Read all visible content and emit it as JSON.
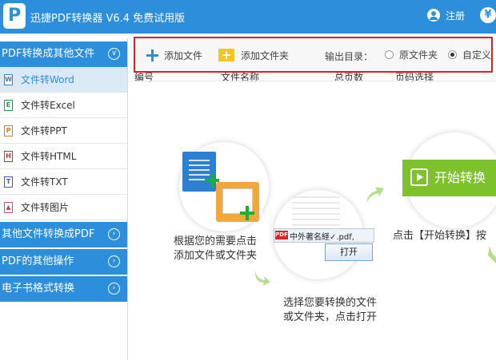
{
  "window": {
    "logo_letter": "P",
    "title": "迅捷PDF转换器 V6.4 免费试用版",
    "register_label": "注册",
    "currency_symbol": "¥"
  },
  "sidebar": {
    "sections": [
      {
        "label": "PDF转换成其他文件",
        "expanded": true,
        "items": [
          {
            "label": "文件转Word",
            "icon_text": "W",
            "active": true
          },
          {
            "label": "文件转Excel",
            "icon_text": "E",
            "active": false
          },
          {
            "label": "文件转PPT",
            "icon_text": "P",
            "active": false
          },
          {
            "label": "文件转HTML",
            "icon_text": "H",
            "active": false
          },
          {
            "label": "文件转TXT",
            "icon_text": "T",
            "active": false
          },
          {
            "label": "文件转图片",
            "icon_text": "▲",
            "active": false
          }
        ]
      },
      {
        "label": "其他文件转换成PDF",
        "expanded": false
      },
      {
        "label": "PDF的其他操作",
        "expanded": false
      },
      {
        "label": "电子书格式转换",
        "expanded": false
      }
    ]
  },
  "toolbar": {
    "add_file_label": "添加文件",
    "add_folder_label": "添加文件夹",
    "output_label": "输出目录：",
    "output_options": [
      {
        "label": "原文件夹",
        "checked": false
      },
      {
        "label": "自定义",
        "checked": true
      }
    ]
  },
  "table": {
    "columns": [
      "编号",
      "文件名称",
      "总页数",
      "页码选择"
    ]
  },
  "guide": {
    "step1": [
      "根据您的需要点击",
      "添加文件或文件夹"
    ],
    "step2": [
      "选择您要转换的文件",
      "或文件夹，点击打开"
    ],
    "step3": "点击【开始转换】按",
    "dialog_pdf_tag": "PDF",
    "dialog_file_name": "中外著名経✓.pdf,",
    "open_button": "打开",
    "start_button": "开始转换"
  },
  "colors": {
    "brand_blue": "#2d8fdc",
    "highlight_red": "#e02020",
    "accent_green": "#7dc22b",
    "folder_orange": "#f3a63b"
  }
}
